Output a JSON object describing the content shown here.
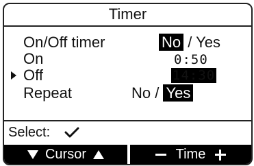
{
  "title": "Timer",
  "rows": {
    "on_off_timer": {
      "label": "On/Off timer",
      "option_no": "No",
      "separator": " / ",
      "option_yes": "Yes",
      "selected": "No"
    },
    "on": {
      "label": "On",
      "time": "0:50"
    },
    "off": {
      "label": "Off",
      "time": "14:30"
    },
    "repeat": {
      "label": "Repeat",
      "option_no": "No",
      "separator": " / ",
      "option_yes": "Yes",
      "selected": "Yes"
    }
  },
  "cursor_row": "off",
  "footer": {
    "select_label": "Select:",
    "select_icon": "checkmark-icon",
    "softkey_cursor_label": "Cursor",
    "softkey_time_label": "Time"
  }
}
